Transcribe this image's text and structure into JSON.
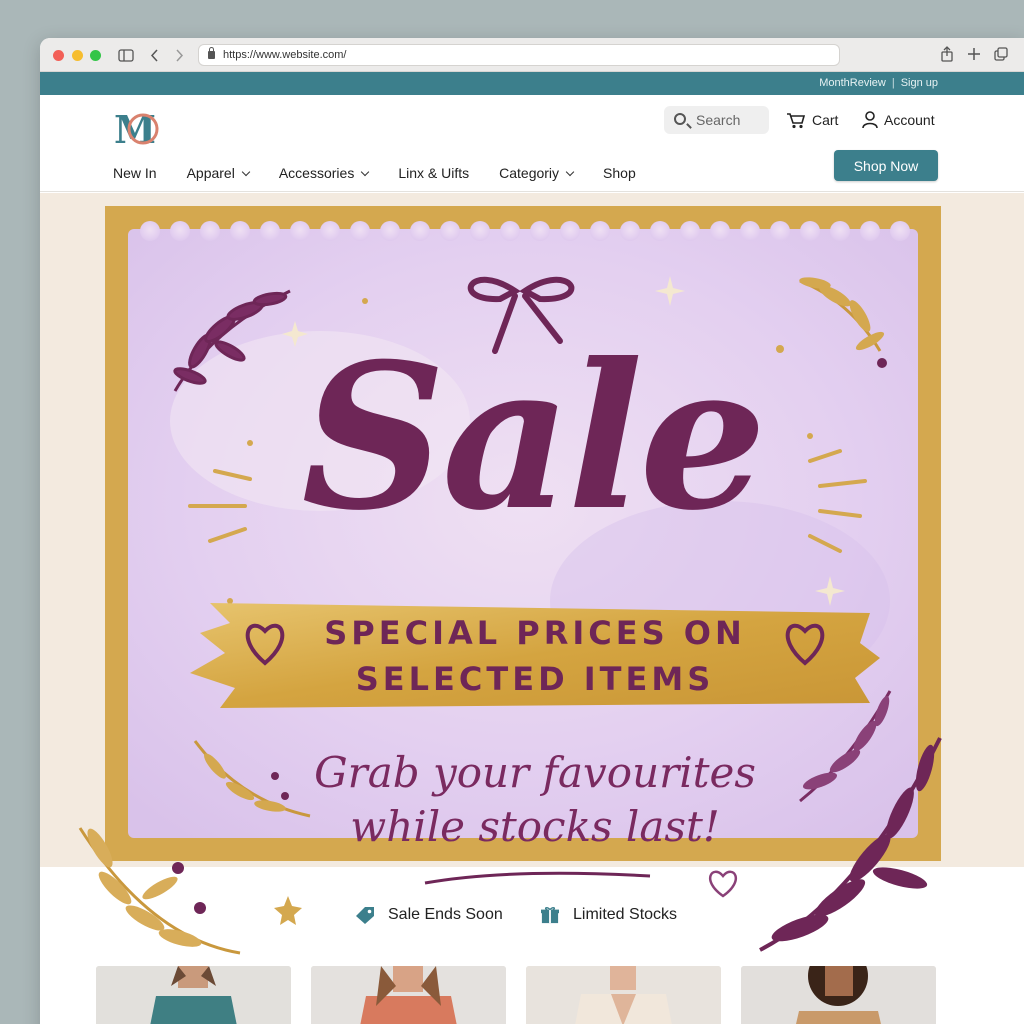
{
  "browser": {
    "url": "https://www.website.com/",
    "icons": [
      "sidebar-icon",
      "back-icon",
      "forward-icon",
      "lock-icon",
      "share-icon",
      "new-tab-icon",
      "tabs-icon"
    ]
  },
  "util": {
    "review": "MonthReview",
    "signup": "Sign up"
  },
  "header": {
    "logo_text": "MC",
    "search_placeholder": "Search",
    "cart": "Cart",
    "account": "Account",
    "shop_now": "Shop Now"
  },
  "nav": {
    "items": [
      "New In",
      "Apparel",
      "Accessories",
      "Linx & Uifts",
      "Categoriy",
      "Shop"
    ]
  },
  "hero": {
    "title": "Sale",
    "special_line1": "SPECIAL PRICES ON",
    "special_line2": "SELECTED ITEMS",
    "tagline_line1": "Grab your favourites",
    "tagline_line2": "while stocks last!"
  },
  "badges": {
    "sale_ends": "Sale Ends Soon",
    "limited": "Limited Stocks"
  },
  "colors": {
    "teal": "#3c7f8c",
    "plum": "#6e2657",
    "gold": "#d4a84f",
    "lavender": "#e6d4f0"
  }
}
